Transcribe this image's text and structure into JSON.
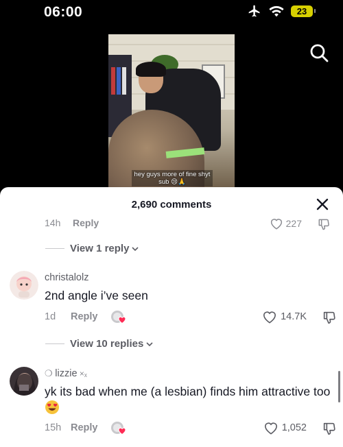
{
  "status": {
    "time": "06:00",
    "battery": "23"
  },
  "video": {
    "caption": "hey guys more of fine shyt sub 😢🙏"
  },
  "comments_sheet": {
    "title": "2,690 comments",
    "clipped_row": {
      "time": "14h",
      "reply": "Reply",
      "likes": "227"
    },
    "view_replies_1": "View 1 reply",
    "comments": [
      {
        "username": "christalolz",
        "text": "2nd angle i’ve seen",
        "time": "1d",
        "reply": "Reply",
        "likes": "14.7K"
      },
      {
        "username": "lizzie",
        "text": "yk its bad when me (a lesbian) finds him attractive too",
        "time": "15h",
        "reply": "Reply",
        "likes": "1,052"
      }
    ],
    "view_replies_2": "View 10 replies"
  },
  "colors": {
    "liked_red": "#fe2c55",
    "battery_yellow": "#d7d000"
  },
  "icons": [
    "airplane-icon",
    "wifi-icon",
    "battery-icon",
    "search-icon",
    "close-icon",
    "heart-icon",
    "dislike-icon",
    "chevron-down-icon",
    "heart-eyes-emoji-icon"
  ]
}
